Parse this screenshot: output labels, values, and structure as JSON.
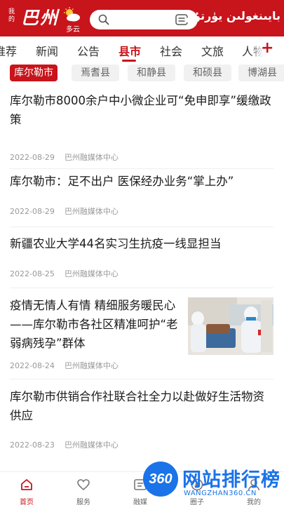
{
  "header": {
    "logo_small": "我的",
    "logo_big": "巴州",
    "weather": {
      "icon": "partly-cloudy-icon",
      "text": "多云"
    },
    "search": {
      "placeholder": "",
      "scan_icon": "scan-icon"
    },
    "uyghur_title": "بايىنغولىن يۈرتۇم"
  },
  "tabs": {
    "items": [
      {
        "label": "推荐",
        "active": false
      },
      {
        "label": "新闻",
        "active": false
      },
      {
        "label": "公告",
        "active": false
      },
      {
        "label": "县市",
        "active": true
      },
      {
        "label": "社会",
        "active": false
      },
      {
        "label": "文旅",
        "active": false
      },
      {
        "label": "人物",
        "active": false
      }
    ],
    "add_icon": "plus-icon"
  },
  "chips": {
    "items": [
      {
        "label": "库尔勒市",
        "active": true
      },
      {
        "label": "焉耆县",
        "active": false
      },
      {
        "label": "和静县",
        "active": false
      },
      {
        "label": "和硕县",
        "active": false
      },
      {
        "label": "博湖县",
        "active": false
      }
    ]
  },
  "news": [
    {
      "title": "库尔勒市8000余户中小微企业可“免申即享”缓缴政策",
      "date": "2022-08-29",
      "source": "巴州融媒体中心",
      "has_image": false
    },
    {
      "title": "库尔勒市：足不出户 医保经办业务“掌上办”",
      "date": "2022-08-29",
      "source": "巴州融媒体中心",
      "has_image": false
    },
    {
      "title": "新疆农业大学44名实习生抗疫一线显担当",
      "date": "2022-08-25",
      "source": "巴州融媒体中心",
      "has_image": false
    },
    {
      "title": "疫情无情人有情 精细服务暖民心 ——库尔勒市各社区精准呵护“老弱病残孕”群体",
      "date": "2022-08-24",
      "source": "巴州融媒体中心",
      "has_image": true
    },
    {
      "title": "库尔勒市供销合作社联合社全力以赴做好生活物资供应",
      "date": "2022-08-23",
      "source": "巴州融媒体中心",
      "has_image": false
    }
  ],
  "bottom_nav": {
    "items": [
      {
        "label": "首页",
        "icon": "home-icon",
        "active": true
      },
      {
        "label": "服务",
        "icon": "heart-icon",
        "active": false
      },
      {
        "label": "融媒",
        "icon": "media-icon",
        "active": false
      },
      {
        "label": "圈子",
        "icon": "circle-icon",
        "active": false
      },
      {
        "label": "我的",
        "icon": "user-icon",
        "active": false
      }
    ]
  },
  "watermark": {
    "badge": "360",
    "title": "网站排行榜",
    "url": "WANGZHAN360.CN"
  },
  "colors": {
    "brand_red": "#c8141b",
    "watermark_blue": "#1a73e8",
    "meta_gray": "#999999"
  }
}
